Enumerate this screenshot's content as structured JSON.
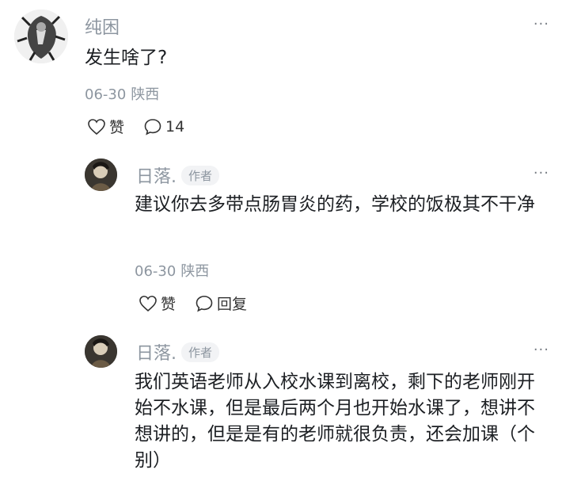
{
  "comments": [
    {
      "user": "纯困",
      "content": "发生啥了?",
      "date": "06-30",
      "location": "陕西",
      "like_label": "赞",
      "reply_count": "14",
      "more": "···"
    },
    {
      "user": "日落.",
      "author_tag": "作者",
      "content": "建议你去多带点肠胃炎的药，学校的饭极其不干净",
      "date": "06-30",
      "location": "陕西",
      "like_label": "赞",
      "reply_label": "回复",
      "more": "···"
    },
    {
      "user": "日落.",
      "author_tag": "作者",
      "content": "我们英语老师从入校水课到离校，剩下的老师刚开始不水课，但是最后两个月也开始水课了，想讲不想讲的，但是是有的老师就很负责，还会加课（个别）",
      "more": "···"
    }
  ],
  "icons": {
    "like": "heart-outline-icon",
    "comment": "speech-bubble-icon",
    "more": "more-horizontal-icon"
  }
}
